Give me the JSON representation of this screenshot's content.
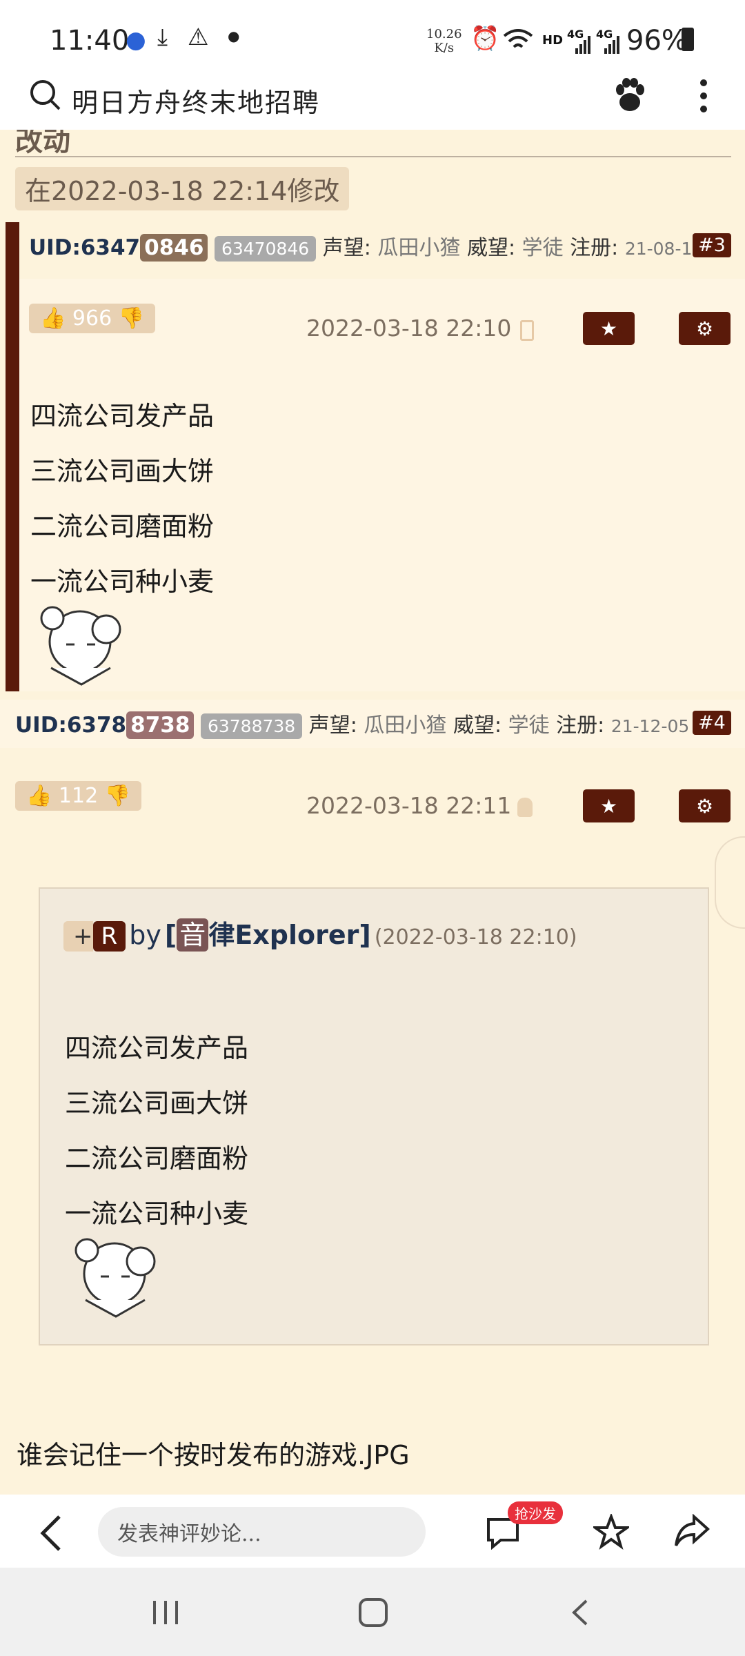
{
  "status": {
    "time": "11:40",
    "net_speed_value": "10.26",
    "net_speed_unit": "K/s",
    "network_label": "HD",
    "sig1": "4G",
    "sig2": "4G",
    "battery": "96%"
  },
  "search": {
    "query": "明日方舟终末地招聘"
  },
  "post_top": {
    "cut_heading": "改动",
    "edit_note": "在2022-03-18 22:14修改"
  },
  "post3": {
    "uid_prefix": "UID:6347",
    "uid_highlight": "0846",
    "uid_full": "63470846",
    "rep_key": "声望:",
    "rep_val": "瓜田小猹",
    "prestige_key": "威望:",
    "prestige_val": "学徒",
    "reg_key": "注册:",
    "reg_val": "21-08-10",
    "floor": "#3",
    "likes": "966",
    "date": "2022-03-18 22:10",
    "lines": [
      "四流公司发产品",
      "三流公司画大饼",
      "二流公司磨面粉",
      "一流公司种小麦"
    ]
  },
  "post4": {
    "uid_prefix": "UID:6378",
    "uid_highlight": "8738",
    "uid_full": "63788738",
    "rep_key": "声望:",
    "rep_val": "瓜田小猹",
    "prestige_key": "威望:",
    "prestige_val": "学徒",
    "reg_key": "注册:",
    "reg_val": "21-12-05",
    "floor": "#4",
    "likes": "112",
    "date": "2022-03-18 22:11",
    "quote": {
      "plus": "+",
      "r": "R",
      "by": "by",
      "bracket_open": "[",
      "author_char": "音",
      "author_rest": "律Explorer",
      "bracket_close": "]",
      "time": "(2022-03-18 22:10)",
      "lines": [
        "四流公司发产品",
        "三流公司画大饼",
        "二流公司磨面粉",
        "一流公司种小麦"
      ]
    },
    "text": "谁会记住一个按时发布的游戏.JPG"
  },
  "bottom": {
    "comment_placeholder": "发表神评妙论...",
    "badge": "抢沙发"
  }
}
